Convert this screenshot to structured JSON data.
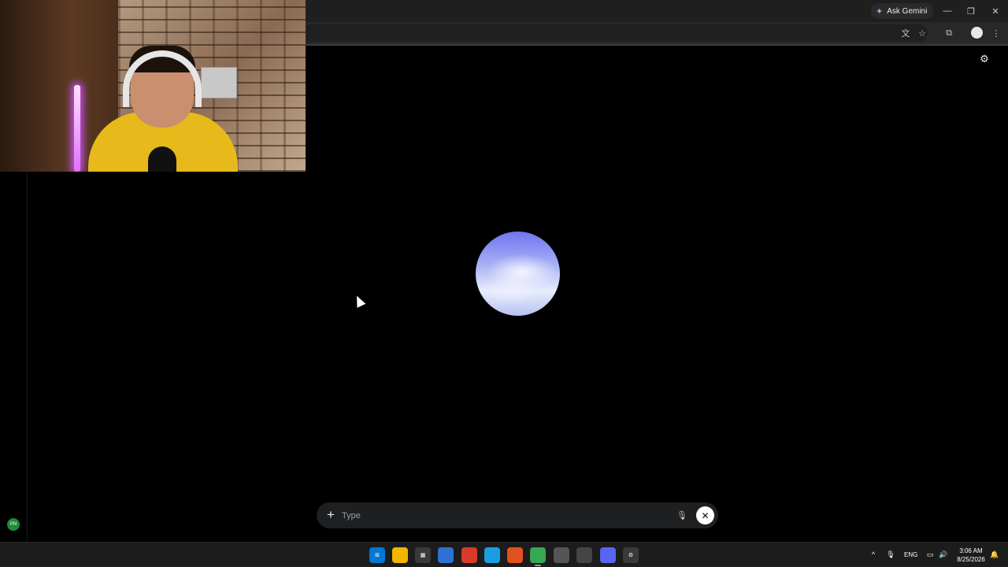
{
  "browser": {
    "ask_gemini_label": "Ask Gemini",
    "icons": [
      "sparkle-icon",
      "minimize-icon",
      "restore-icon",
      "close-icon",
      "translate-icon",
      "bookmark-star-icon",
      "extensions-icon",
      "profile-icon",
      "more-vert-icon"
    ]
  },
  "page": {
    "settings_icon": "tune-icon",
    "user_initials": "PN"
  },
  "chat": {
    "placeholder": "Type",
    "add_icon": "+",
    "mic_icon": "mic-off-icon",
    "close_icon": "✕"
  },
  "taskbar": {
    "apps": [
      "start-icon",
      "file-explorer-icon",
      "store-icon",
      "notepad-icon",
      "video-editor-icon",
      "edge-icon",
      "brave-icon",
      "chrome-icon",
      "camera-icon",
      "settings-alt-icon",
      "discord-icon",
      "gear-icon"
    ],
    "lang": "ENG",
    "time": "3:06 AM",
    "date": "8/25/2026"
  },
  "colors": {
    "background": "#000000",
    "chrome_dark": "#1f1f1f",
    "orb_top": "#6f74ef",
    "orb_bottom": "#e7ecfb"
  }
}
